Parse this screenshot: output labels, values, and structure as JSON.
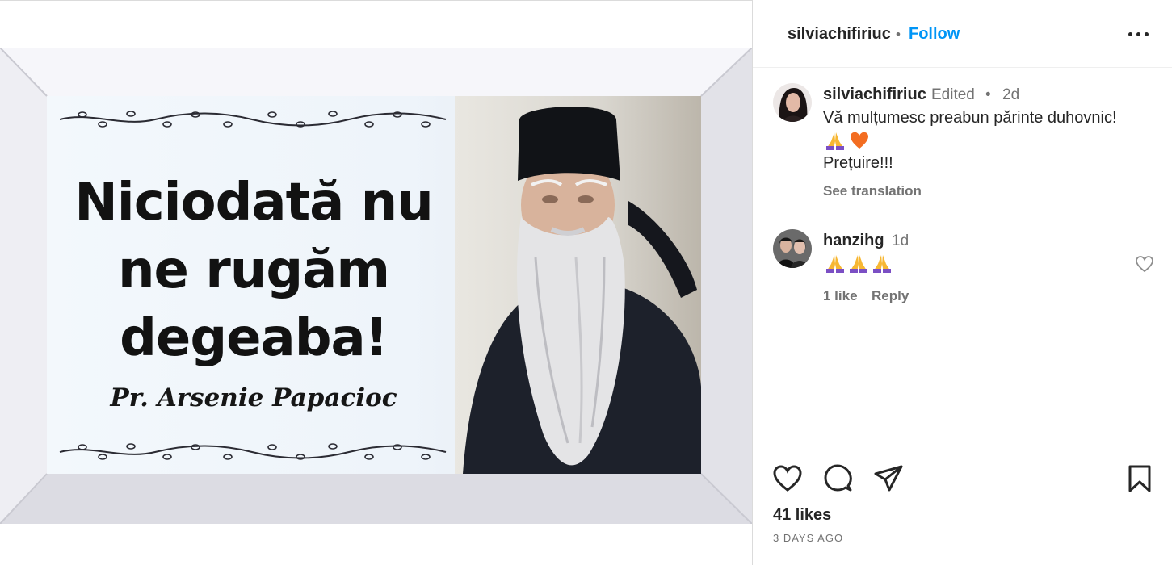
{
  "post": {
    "image": {
      "quote_lines": [
        "Niciodată nu",
        "ne rugăm",
        "degeaba!"
      ],
      "author": "Pr. Arsenie Papacioc"
    }
  },
  "header": {
    "username": "silviachifiriuc",
    "separator": "•",
    "follow_label": "Follow"
  },
  "caption": {
    "username": "silviachifiriuc",
    "edited_label": "Edited",
    "separator": "•",
    "time": "2d",
    "text_line1": "Vă mulțumesc preabun părinte duhovnic!",
    "emojis": [
      "folded-hands",
      "orange-heart"
    ],
    "text_line2": "Prețuire!!!",
    "see_translation": "See translation"
  },
  "comments": [
    {
      "username": "hanzihg",
      "time": "1d",
      "emojis": [
        "folded-hands",
        "folded-hands",
        "folded-hands"
      ],
      "likes_label": "1 like",
      "reply_label": "Reply"
    }
  ],
  "footer": {
    "likes_label": "41 likes",
    "date_label": "3 DAYS AGO"
  },
  "colors": {
    "accent": "#0095f6",
    "text": "#262626",
    "secondary": "#737373",
    "border": "#dbdbdb"
  }
}
